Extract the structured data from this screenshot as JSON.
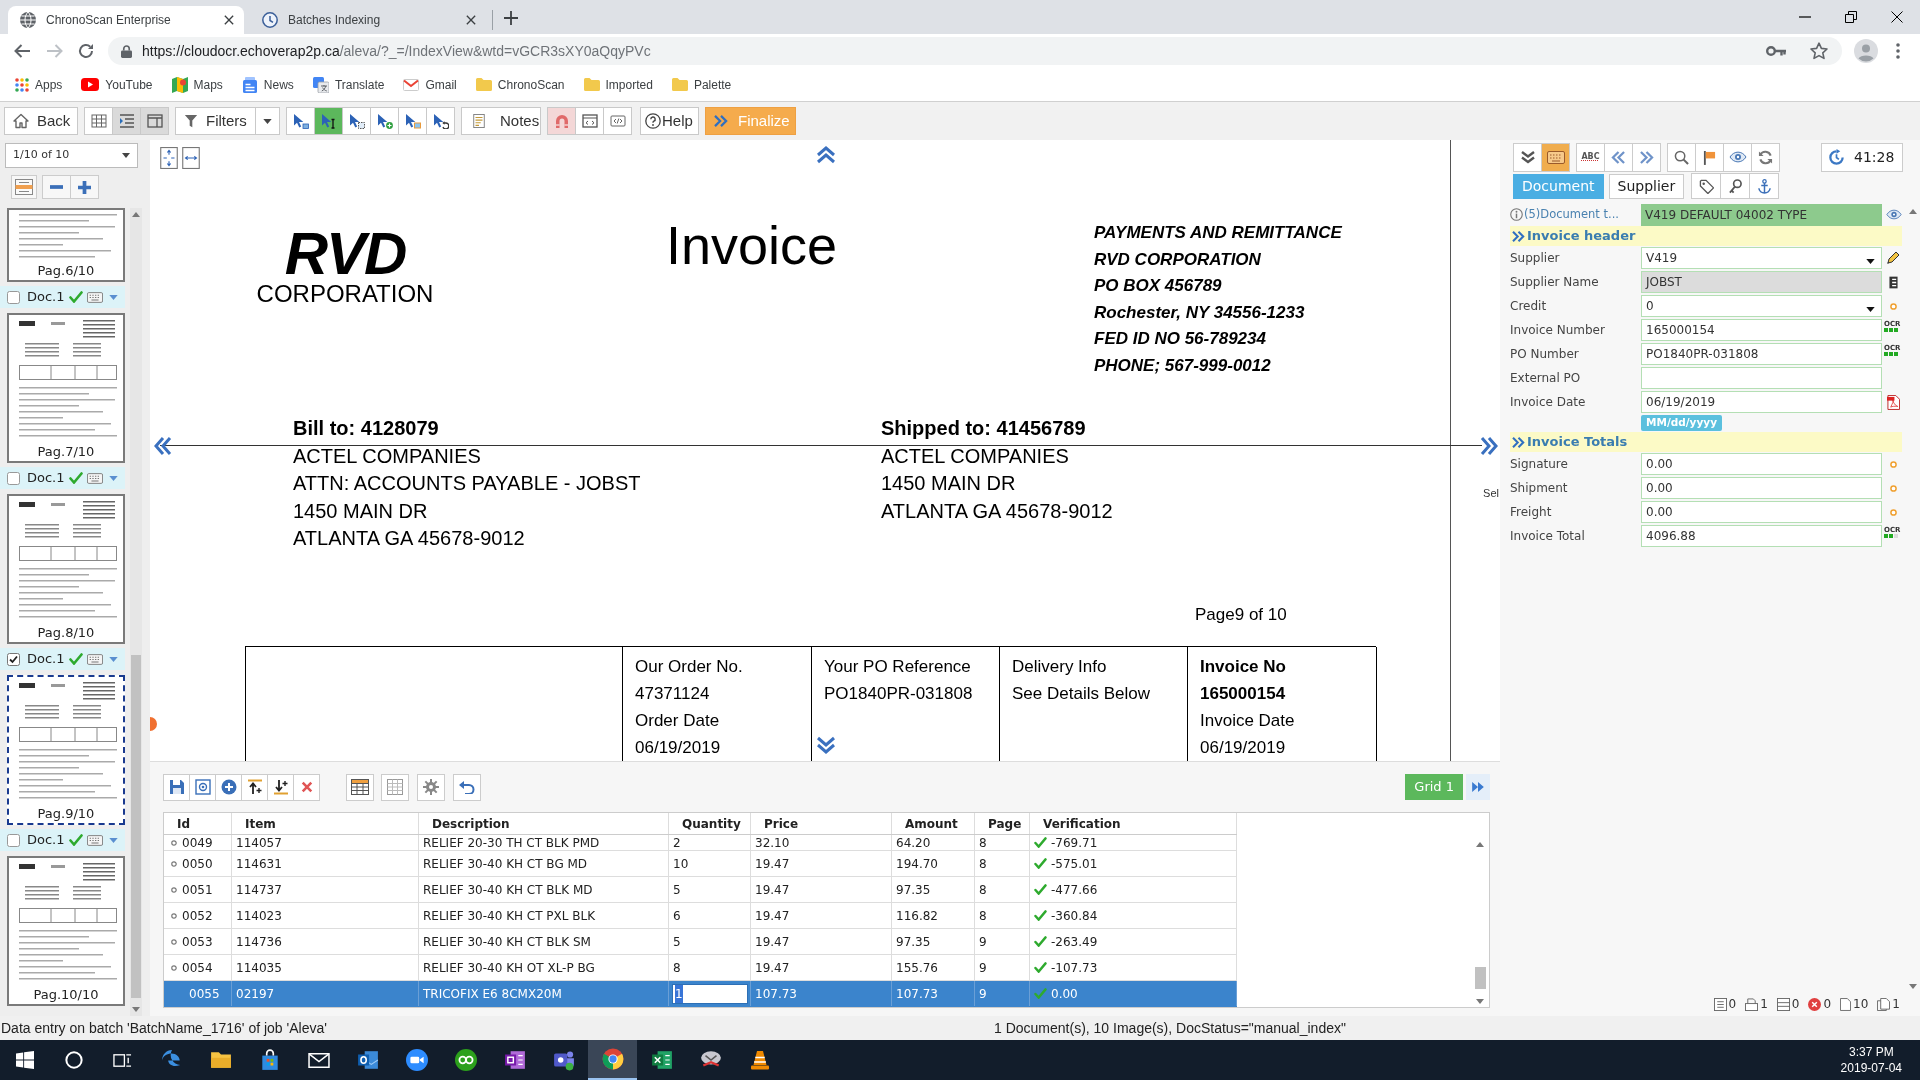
{
  "browser": {
    "tabs": [
      {
        "title": "ChronoScan Enterprise",
        "kind": "web",
        "selected": true
      },
      {
        "title": "Batches Indexing",
        "kind": "app",
        "selected": false
      }
    ],
    "forward_enabled": false,
    "url": {
      "host": "https://cloudocr.echoverap2p.ca",
      "path": "/aleva/?_=/IndexView&wtd=vGCR3sXY0aQqyPVc"
    },
    "bookmarks": [
      {
        "label": "Apps",
        "kind": "apps"
      },
      {
        "label": "YouTube",
        "kind": "video"
      },
      {
        "label": "Maps",
        "kind": "map"
      },
      {
        "label": "News",
        "kind": "news"
      },
      {
        "label": "Translate",
        "kind": "translate"
      },
      {
        "label": "Gmail",
        "kind": "mail"
      },
      {
        "label": "ChronoScan",
        "kind": "folder"
      },
      {
        "label": "Imported",
        "kind": "folder"
      },
      {
        "label": "Palette",
        "kind": "folder"
      }
    ]
  },
  "toolbar": {
    "back": "Back",
    "view_buttons": [
      {
        "kind": "grid",
        "selected": false
      },
      {
        "kind": "outline",
        "selected": true
      },
      {
        "kind": "split",
        "selected": true
      }
    ],
    "filters": "Filters",
    "cursor_tools": [
      {
        "kind": "pointer",
        "selected": false
      },
      {
        "kind": "text",
        "selected": true
      },
      {
        "kind": "zone",
        "selected": false
      },
      {
        "kind": "add",
        "selected": false
      },
      {
        "kind": "image",
        "selected": false
      },
      {
        "kind": "undo",
        "selected": false
      }
    ],
    "notes": "Notes",
    "mode_buttons": [
      {
        "kind": "magnet",
        "selected": true
      },
      {
        "kind": "frame",
        "selected": false
      },
      {
        "kind": "code",
        "selected": false
      }
    ],
    "help": "Help",
    "finalize": "Finalize"
  },
  "thumbnails": {
    "page_selector": "1/10 of 10",
    "items": [
      {
        "kind": "page",
        "label": "Pag.6/10",
        "selected": false
      },
      {
        "kind": "doc",
        "label": "Doc.1",
        "checked": false
      },
      {
        "kind": "page",
        "label": "Pag.7/10",
        "selected": false
      },
      {
        "kind": "doc",
        "label": "Doc.1",
        "checked": false
      },
      {
        "kind": "page",
        "label": "Pag.8/10",
        "selected": false
      },
      {
        "kind": "doc",
        "label": "Doc.1",
        "checked": true
      },
      {
        "kind": "page",
        "label": "Pag.9/10",
        "selected": true
      },
      {
        "kind": "doc",
        "label": "Doc.1",
        "checked": false
      },
      {
        "kind": "page",
        "label": "Pag.10/10",
        "selected": false
      }
    ]
  },
  "document": {
    "logo_mark": "RVD",
    "logo_name": "CORPORATION",
    "title": "Invoice",
    "remit_lines": [
      "PAYMENTS AND REMITTANCE",
      "RVD CORPORATION",
      "PO BOX 456789",
      "Rochester, NY 34556-1233",
      "FED ID NO 56-789234",
      "PHONE; 567-999-0012"
    ],
    "bill_to": {
      "heading": "Bill to: 4128079",
      "lines": [
        "ACTEL COMPANIES",
        "ATTN: ACCOUNTS PAYABLE - JOBST",
        "1450 MAIN DR",
        "ATLANTA GA 45678-9012"
      ]
    },
    "ship_to": {
      "heading": "Shipped to: 41456789",
      "lines": [
        "ACTEL COMPANIES",
        "1450 MAIN DR",
        "ATLANTA GA 45678-9012"
      ]
    },
    "page_label": "Page9 of 10",
    "info_table": [
      {
        "lines": [
          {
            "text": "Our Order No.",
            "bold": false
          },
          {
            "text": "47371124",
            "bold": false
          },
          {
            "text": "Order Date",
            "bold": false
          },
          {
            "text": "06/19/2019",
            "bold": false
          }
        ]
      },
      {
        "lines": [
          {
            "text": "Your PO Reference",
            "bold": false
          },
          {
            "text": "PO1840PR-031808",
            "bold": false
          }
        ]
      },
      {
        "lines": [
          {
            "text": "Delivery Info",
            "bold": false
          },
          {
            "text": "See Details Below",
            "bold": false
          }
        ]
      },
      {
        "lines": [
          {
            "text": "Invoice No",
            "bold": true
          },
          {
            "text": "165000154",
            "bold": true
          },
          {
            "text": "Invoice Date",
            "bold": false
          },
          {
            "text": "06/19/2019",
            "bold": false
          }
        ]
      }
    ],
    "edge_label": "Sel"
  },
  "index_panel": {
    "tool_groups": [
      [
        {
          "kind": "approve",
          "selected": false
        },
        {
          "kind": "keyboard",
          "selected": true
        }
      ],
      [
        {
          "kind": "spellcheck",
          "text": "ABC",
          "selected": false
        },
        {
          "kind": "prev",
          "selected": false
        },
        {
          "kind": "next",
          "selected": false
        }
      ],
      [
        {
          "kind": "search",
          "selected": false
        },
        {
          "kind": "flag",
          "selected": false
        },
        {
          "kind": "eye",
          "selected": false
        },
        {
          "kind": "refresh",
          "selected": false
        }
      ]
    ],
    "timer": "41:28",
    "tabs": [
      {
        "label": "Document",
        "selected": true
      },
      {
        "label": "Supplier",
        "selected": false
      }
    ],
    "doc_type": {
      "label": "(5)Document t...",
      "value": "V419 DEFAULT 04002 TYPE"
    },
    "sections": [
      {
        "title": "Invoice header",
        "fields": [
          {
            "label": "Supplier",
            "value": "V419",
            "kind": "dropdown",
            "indicator": {
              "kind": "pencil"
            }
          },
          {
            "label": "Supplier Name",
            "value": "JOBST",
            "kind": "readonly",
            "indicator": {
              "kind": "list"
            }
          },
          {
            "label": "Credit",
            "value": "0",
            "kind": "dropdown",
            "indicator": {
              "kind": "dot"
            }
          },
          {
            "label": "Invoice Number",
            "value": "165000154",
            "kind": "text",
            "indicator": {
              "kind": "ocr",
              "text": "OCR",
              "stars": 3
            }
          },
          {
            "label": "PO Number",
            "value": "PO1840PR-031808",
            "kind": "text",
            "indicator": {
              "kind": "ocr",
              "text": "OCR",
              "stars": 3
            }
          },
          {
            "label": "External PO",
            "kind": "text"
          },
          {
            "label": "Invoice Date",
            "value": "06/19/2019",
            "kind": "text",
            "indicator": {
              "kind": "pdf"
            },
            "format_hint": "MM/dd/yyyy"
          }
        ]
      },
      {
        "title": "Invoice Totals",
        "fields": [
          {
            "label": "Signature",
            "value": "0.00",
            "kind": "text",
            "indicator": {
              "kind": "dot"
            }
          },
          {
            "label": "Shipment",
            "value": "0.00",
            "kind": "text",
            "indicator": {
              "kind": "dot"
            }
          },
          {
            "label": "Freight",
            "value": "0.00",
            "kind": "text",
            "indicator": {
              "kind": "dot"
            }
          },
          {
            "label": "Invoice Total",
            "value": "4096.88",
            "kind": "text",
            "indicator": {
              "kind": "ocr",
              "text": "OCR",
              "stars": 2
            }
          }
        ]
      }
    ],
    "counters": [
      {
        "kind": "documents",
        "count": "0"
      },
      {
        "kind": "scans",
        "count": "1"
      },
      {
        "kind": "batches",
        "count": "0"
      },
      {
        "kind": "errors",
        "count": "0"
      },
      {
        "kind": "pages",
        "count": "10"
      },
      {
        "kind": "copies",
        "count": "1"
      }
    ]
  },
  "grid": {
    "title": "Grid 1",
    "columns": [
      "Id",
      "Item",
      "Description",
      "Quantity",
      "Price",
      "Amount",
      "Page",
      "Verification"
    ],
    "rows": [
      {
        "cells": [
          "0049",
          "114057",
          "RELIEF 20-30 TH CT BLK PMD",
          "2",
          "32.10",
          "64.20",
          "8",
          "-769.71"
        ],
        "verified": true,
        "selected": false
      },
      {
        "cells": [
          "0050",
          "114631",
          "RELIEF 30-40 KH CT BG MD",
          "10",
          "19.47",
          "194.70",
          "8",
          "-575.01"
        ],
        "verified": true,
        "selected": false
      },
      {
        "cells": [
          "0051",
          "114737",
          "RELIEF 30-40 KH CT BLK MD",
          "5",
          "19.47",
          "97.35",
          "8",
          "-477.66"
        ],
        "verified": true,
        "selected": false
      },
      {
        "cells": [
          "0052",
          "114023",
          "RELIEF 30-40 KH CT PXL BLK",
          "6",
          "19.47",
          "116.82",
          "8",
          "-360.84"
        ],
        "verified": true,
        "selected": false
      },
      {
        "cells": [
          "0053",
          "114736",
          "RELIEF 30-40 KH CT BLK SM",
          "5",
          "19.47",
          "97.35",
          "9",
          "-263.49"
        ],
        "verified": true,
        "selected": false
      },
      {
        "cells": [
          "0054",
          "114035",
          "RELIEF 30-40 KH OT XL-P BG",
          "8",
          "19.47",
          "155.76",
          "9",
          "-107.73"
        ],
        "verified": true,
        "selected": false
      },
      {
        "cells": [
          "0055",
          "02197",
          "TRICOFIX E6 8CMX20M",
          "1",
          "107.73",
          "107.73",
          "9",
          "0.00"
        ],
        "verified": true,
        "selected": true
      }
    ]
  },
  "status_bar": {
    "left": "Data entry on batch 'BatchName_1716' of job 'Aleva'",
    "right": "1 Document(s), 10 Image(s), DocStatus=\"manual_index\""
  },
  "taskbar": {
    "items": [
      {
        "kind": "start",
        "selected": false
      },
      {
        "kind": "search",
        "selected": false
      },
      {
        "kind": "task_view",
        "selected": false
      },
      {
        "kind": "web_browser",
        "selected": false
      },
      {
        "kind": "file_manager",
        "selected": false
      },
      {
        "kind": "store",
        "selected": false
      },
      {
        "kind": "mail",
        "selected": false
      },
      {
        "kind": "mail_client",
        "selected": false
      },
      {
        "kind": "video_meeting",
        "selected": false
      },
      {
        "kind": "accounting",
        "selected": false
      },
      {
        "kind": "notes",
        "selected": false
      },
      {
        "kind": "chat",
        "selected": false
      },
      {
        "kind": "browser",
        "selected": true
      },
      {
        "kind": "spreadsheet",
        "selected": false
      },
      {
        "kind": "app",
        "selected": false
      },
      {
        "kind": "media_player",
        "selected": false
      }
    ],
    "time": "3:37 PM",
    "date": "2019-07-04"
  }
}
